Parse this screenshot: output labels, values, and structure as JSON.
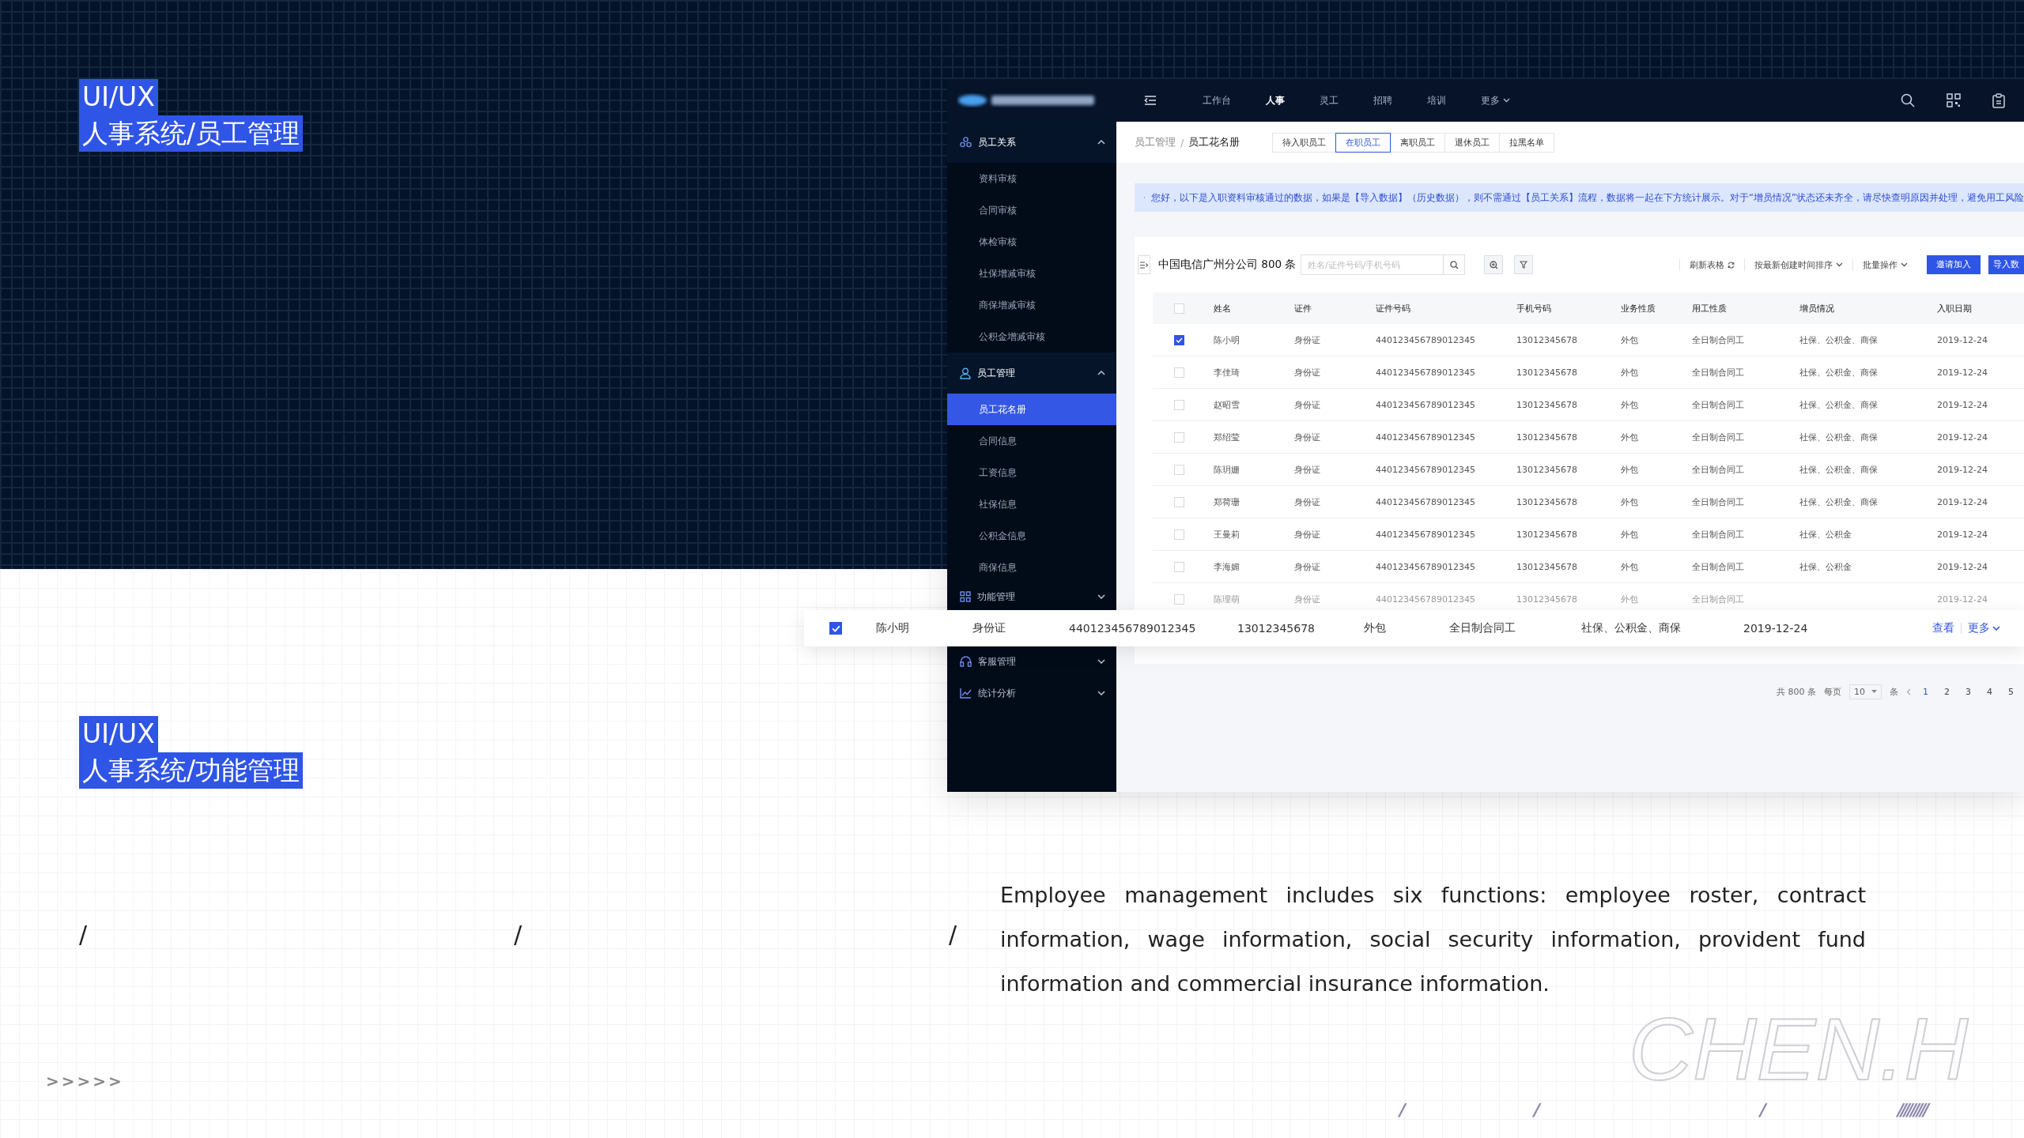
{
  "slide": {
    "labels": [
      {
        "tag": "UI/UX",
        "title": "人事系统/员工管理"
      },
      {
        "tag": "UI/UX",
        "title": "人事系统/功能管理"
      }
    ],
    "description": "Employee management includes six functions: employee roster, contract information, wage information, social security information, provident fund information and commercial insurance information.",
    "slashes": [
      "/",
      "/",
      "/"
    ],
    "chevrons": ">>>>>",
    "marks": [
      "/",
      "/",
      "/",
      "/////////"
    ],
    "signature": "CHEN.H"
  },
  "app": {
    "nav": {
      "items": [
        {
          "label": "工作台",
          "selected": false,
          "dropdown": false
        },
        {
          "label": "人事",
          "selected": true,
          "dropdown": false
        },
        {
          "label": "灵工",
          "selected": false,
          "dropdown": false
        },
        {
          "label": "招聘",
          "selected": false,
          "dropdown": false
        },
        {
          "label": "培训",
          "selected": false,
          "dropdown": false
        },
        {
          "label": "更多",
          "selected": false,
          "dropdown": true
        }
      ]
    },
    "sidebar": {
      "groups": [
        {
          "label": "员工关系",
          "expanded": true,
          "children": [
            {
              "label": "资料审核",
              "selected": false
            },
            {
              "label": "合同审核",
              "selected": false
            },
            {
              "label": "体检审核",
              "selected": false
            },
            {
              "label": "社保增减审核",
              "selected": false
            },
            {
              "label": "商保增减审核",
              "selected": false
            },
            {
              "label": "公积金增减审核",
              "selected": false
            }
          ]
        },
        {
          "label": "员工管理",
          "expanded": true,
          "children": [
            {
              "label": "员工花名册",
              "selected": true
            },
            {
              "label": "合同信息",
              "selected": false
            },
            {
              "label": "工资信息",
              "selected": false
            },
            {
              "label": "社保信息",
              "selected": false
            },
            {
              "label": "公积金信息",
              "selected": false
            },
            {
              "label": "商保信息",
              "selected": false
            }
          ]
        },
        {
          "label": "功能管理",
          "expanded": false
        },
        {
          "label": "客服管理",
          "expanded": false
        },
        {
          "label": "统计分析",
          "expanded": false
        }
      ]
    },
    "breadcrumb": [
      "员工管理",
      "员工花名册"
    ],
    "breadcrumb_separator": "/",
    "tabs": [
      {
        "label": "待入职员工",
        "selected": false
      },
      {
        "label": "在职员工",
        "selected": true
      },
      {
        "label": "离职员工",
        "selected": false
      },
      {
        "label": "退休员工",
        "selected": false
      },
      {
        "label": "拉黑名单",
        "selected": false
      }
    ],
    "notice": "您好，以下是入职资料审核通过的数据，如果是【导入数据】（历史数据），则不需通过【员工关系】流程，数据将一起在下方统计展示。对于“增员情况”状态还未齐全，请尽快查明原因并处理，避免用工风险",
    "toolbar": {
      "title": "中国电信广州分公司 800 条",
      "search": {
        "placeholder": "姓名/证件号码/手机号码"
      },
      "actions": [
        {
          "label": "刷新表格",
          "kind": "refresh"
        },
        {
          "label": "按最新创建时间排序",
          "kind": "dropdown"
        },
        {
          "label": "批量操作",
          "kind": "dropdown"
        }
      ],
      "buttons": [
        "邀请加入",
        "导入数"
      ]
    },
    "table": {
      "all_checked": false,
      "columns": [
        "姓名",
        "证件",
        "证件号码",
        "手机号码",
        "业务性质",
        "用工性质",
        "增员情况",
        "入职日期"
      ],
      "rows": [
        {
          "checked": true,
          "cells": [
            "陈小明",
            "身份证",
            "440123456789012345",
            "13012345678",
            "外包",
            "全日制合同工",
            "社保、公积金、商保",
            "2019-12-24"
          ]
        },
        {
          "checked": false,
          "cells": [
            "李佳琦",
            "身份证",
            "440123456789012345",
            "13012345678",
            "外包",
            "全日制合同工",
            "社保、公积金、商保",
            "2019-12-24"
          ]
        },
        {
          "checked": false,
          "cells": [
            "赵昭雪",
            "身份证",
            "440123456789012345",
            "13012345678",
            "外包",
            "全日制合同工",
            "社保、公积金、商保",
            "2019-12-24"
          ]
        },
        {
          "checked": false,
          "cells": [
            "郑绍莹",
            "身份证",
            "440123456789012345",
            "13012345678",
            "外包",
            "全日制合同工",
            "社保、公积金、商保",
            "2019-12-24"
          ]
        },
        {
          "checked": false,
          "cells": [
            "陈玥姗",
            "身份证",
            "440123456789012345",
            "13012345678",
            "外包",
            "全日制合同工",
            "社保、公积金、商保",
            "2019-12-24"
          ]
        },
        {
          "checked": false,
          "cells": [
            "郑荷珊",
            "身份证",
            "440123456789012345",
            "13012345678",
            "外包",
            "全日制合同工",
            "社保、公积金、商保",
            "2019-12-24"
          ]
        },
        {
          "checked": false,
          "cells": [
            "王曼莉",
            "身份证",
            "440123456789012345",
            "13012345678",
            "外包",
            "全日制合同工",
            "社保、公积金",
            "2019-12-24"
          ]
        },
        {
          "checked": false,
          "cells": [
            "李海媚",
            "身份证",
            "440123456789012345",
            "13012345678",
            "外包",
            "全日制合同工",
            "社保、公积金",
            "2019-12-24"
          ]
        },
        {
          "checked": false,
          "cells": [
            "陈理萌",
            "身份证",
            "440123456789012345",
            "13012345678",
            "外包",
            "全日制合同工",
            null,
            "2019-12-24"
          ]
        }
      ]
    },
    "highlight_row": {
      "checked": true,
      "cells": [
        "陈小明",
        "身份证",
        "440123456789012345",
        "13012345678",
        "外包",
        "全日制合同工",
        "社保、公积金、商保",
        "2019-12-24"
      ],
      "actions": [
        {
          "label": "查看",
          "kind": "link"
        },
        {
          "label": "更多",
          "kind": "dropdown"
        }
      ]
    },
    "pagination": {
      "total": "共 800 条",
      "per_page_label": "每页",
      "per_page": "10",
      "unit": "条",
      "pages": [
        {
          "label": "1",
          "selected": true
        },
        {
          "label": "2",
          "selected": false
        },
        {
          "label": "3",
          "selected": false
        },
        {
          "label": "4",
          "selected": false
        },
        {
          "label": "5",
          "selected": false
        }
      ]
    }
  }
}
